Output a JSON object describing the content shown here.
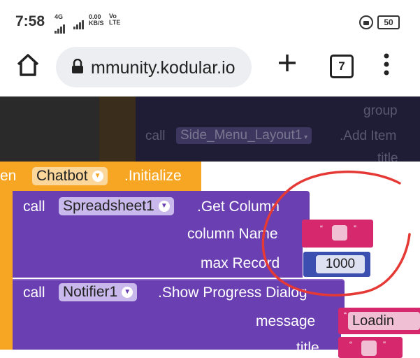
{
  "status_bar": {
    "time": "7:58",
    "net_gen": "4G",
    "speed_value": "0.00",
    "speed_unit": "KB/S",
    "volte_top": "Vo",
    "volte_bottom": "LTE",
    "battery": "50"
  },
  "browser": {
    "url": "mmunity.kodular.io",
    "tab_count": "7"
  },
  "bg_blocks": {
    "group_label": "group",
    "call_label": "call",
    "component": "Side_Menu_Layout1",
    "method": ".Add Item",
    "title_label": "title"
  },
  "event_block": {
    "prefix": "en",
    "component": "Chatbot",
    "event": ".Initialize"
  },
  "get_column_block": {
    "call_label": "call",
    "component": "Spreadsheet1",
    "method": ".Get Column",
    "param1_label": "column Name",
    "param2_label": "max Record",
    "max_record_value": "1000"
  },
  "progress_block": {
    "call_label": "call",
    "component": "Notifier1",
    "method": ".Show Progress Dialog",
    "param1_label": "message",
    "message_value": "Loadin",
    "param2_label": "title"
  },
  "colors": {
    "event": "#f6a623",
    "procedure": "#6a3fb2",
    "text_block": "#d6286c",
    "number_block": "#3a4fb0",
    "annotation": "#e53935"
  }
}
